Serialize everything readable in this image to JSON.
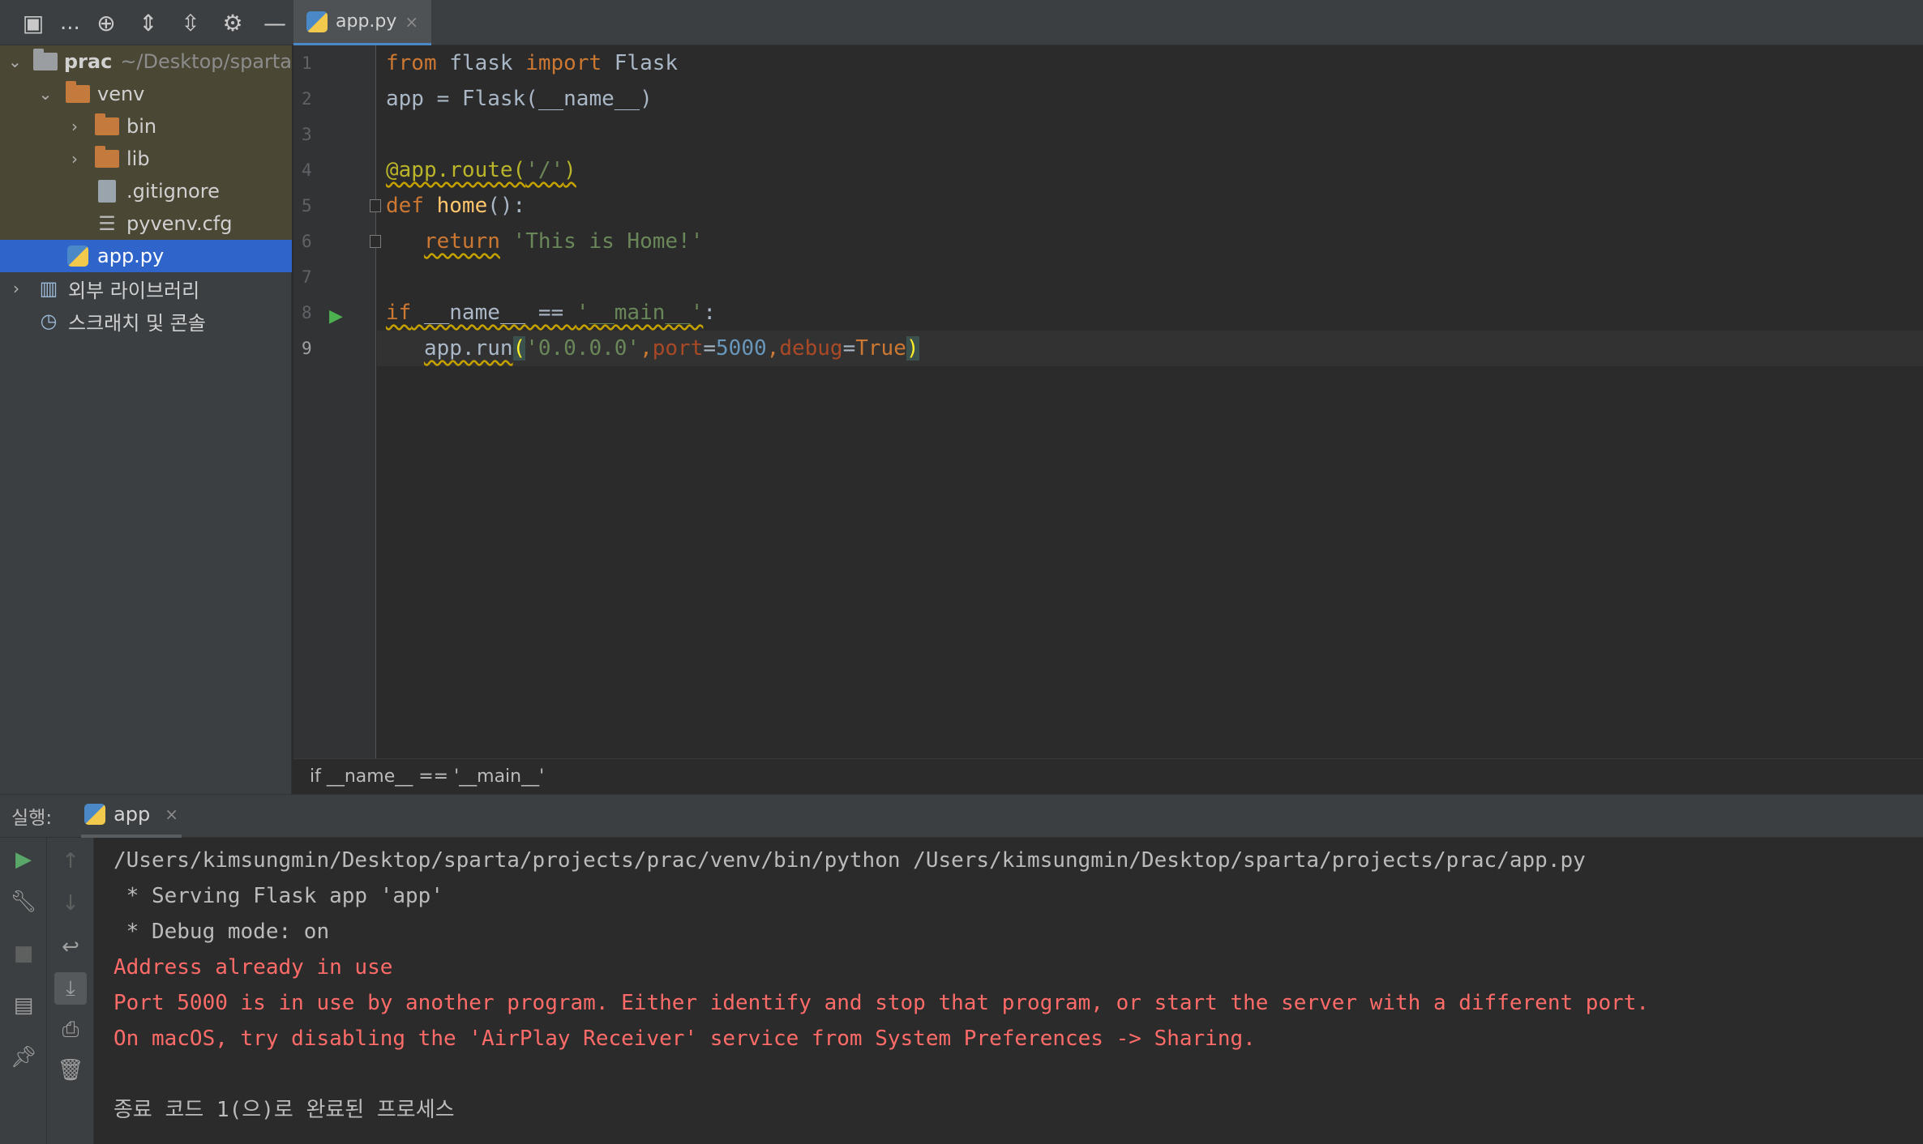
{
  "project_toolbar": {
    "ellipsis": "..."
  },
  "editor_tab": {
    "label": "app.py",
    "close": "×"
  },
  "project_tree": {
    "root": {
      "name": "prac",
      "path": "~/Desktop/sparta"
    },
    "venv": "venv",
    "bin": "bin",
    "lib": "lib",
    "gitignore": ".gitignore",
    "pyvenv": "pyvenv.cfg",
    "app": "app.py",
    "external_libs": "외부 라이브러리",
    "scratches": "스크래치 및 콘솔"
  },
  "line_numbers": [
    "1",
    "2",
    "3",
    "4",
    "5",
    "6",
    "7",
    "8",
    "9"
  ],
  "code": {
    "l1": {
      "kw1": "from",
      "mod": " flask ",
      "kw2": "import",
      "cls": " Flask"
    },
    "l2": {
      "text": "app = Flask(__name__)"
    },
    "l4": {
      "deco": "@app.route(",
      "str": "'/'",
      "close": ")"
    },
    "l5": {
      "kw": "def",
      "fn": "home",
      "rest": "():"
    },
    "l6": {
      "indent": "   ",
      "kw": "return",
      "str": "'This is Home!'"
    },
    "l8": {
      "kw": "if",
      "mid": " __name__ == ",
      "str": "'__main__'",
      "colon": ":"
    },
    "l9": {
      "indent": "   ",
      "call": "app.run",
      "open": "(",
      "host": "'0.0.0.0'",
      "comma1": ",",
      "p1": "port",
      "eq1": "=",
      "port": "5000",
      "comma2": ",",
      "p2": "debug",
      "eq2": "=",
      "debug": "True",
      "close": ")"
    }
  },
  "breadcrumb": "if __name__ == '__main__'",
  "run_panel": {
    "title": "실행:",
    "tab_label": "app",
    "tab_close": "×"
  },
  "console": {
    "lines": [
      "/Users/kimsungmin/Desktop/sparta/projects/prac/venv/bin/python /Users/kimsungmin/Desktop/sparta/projects/prac/app.py",
      " * Serving Flask app 'app'",
      " * Debug mode: on",
      "Address already in use",
      "Port 5000 is in use by another program. Either identify and stop that program, or start the server with a different port.",
      "On macOS, try disabling the 'AirPlay Receiver' service from System Preferences -> Sharing.",
      "",
      "종료 코드 1(으)로 완료된 프로세스"
    ]
  },
  "colors": {
    "selection": "#2f65ca",
    "error_text": "#ff6b68",
    "keyword": "#cc7832",
    "string": "#6a8759",
    "number": "#6897bb",
    "run_green": "#59a869"
  }
}
